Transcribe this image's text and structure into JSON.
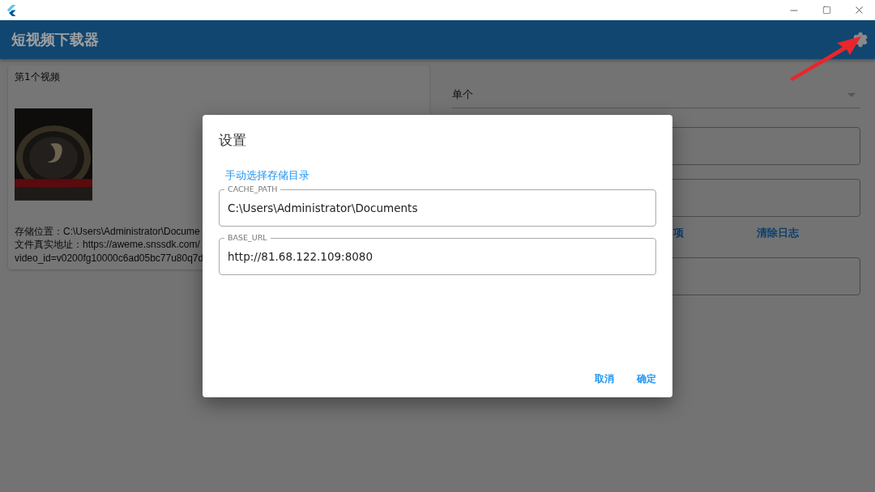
{
  "app_bar": {
    "title": "短视频下载器"
  },
  "video_card": {
    "heading": "第1个视频",
    "lines": [
      "存储位置：C:\\Users\\Administrator\\Docume",
      "文件真实地址：https://aweme.snssdk.com/",
      "video_id=v0200fg10000c6ad05bc77u80q7d"
    ]
  },
  "mode_select": {
    "value": "单个"
  },
  "actions": [
    "项",
    "清除日志"
  ],
  "dialog": {
    "title": "设置",
    "link": "手动选择存储目录",
    "fields": [
      {
        "label": "CACHE_PATH",
        "value": "C:\\Users\\Administrator\\Documents"
      },
      {
        "label": "BASE_URL",
        "value": "http://81.68.122.109:8080"
      }
    ],
    "buttons": [
      "取消",
      "确定"
    ]
  }
}
